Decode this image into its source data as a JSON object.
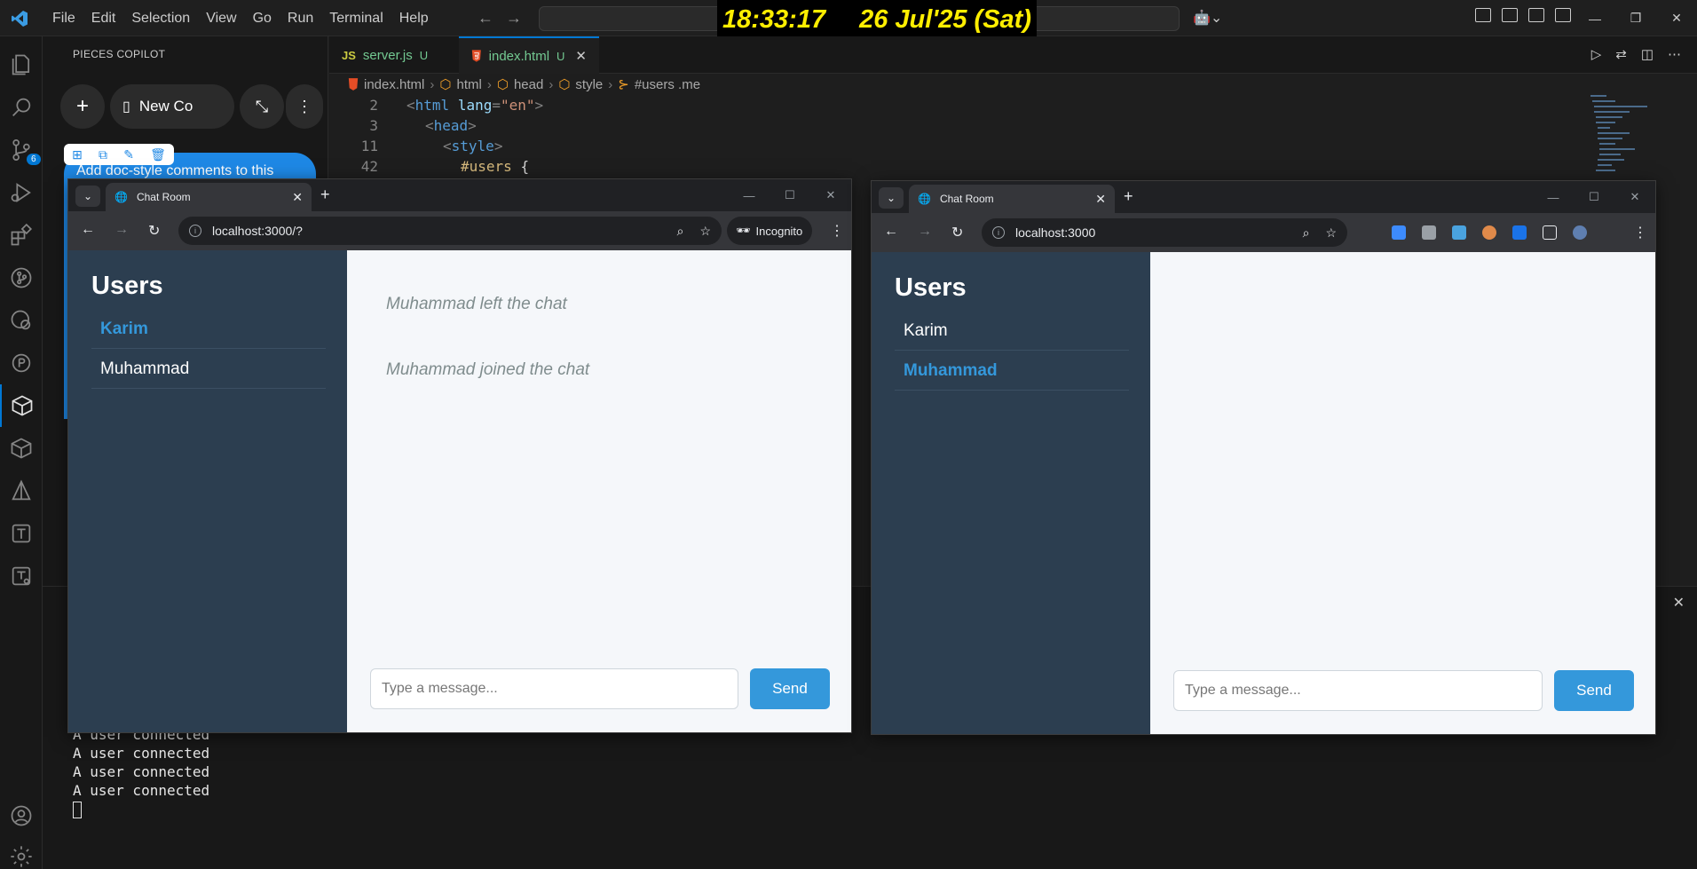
{
  "titlebar": {
    "menu": [
      "File",
      "Edit",
      "Selection",
      "View",
      "Go",
      "Run",
      "Terminal",
      "Help"
    ],
    "clock_time": "18:33:17",
    "clock_date": "26 Jul'25 (Sat)"
  },
  "activity": {
    "scm_badge": "6"
  },
  "pieces": {
    "title": "PIECES COPILOT",
    "new_conv_label": "New Co",
    "bubble_text": "Add doc-style comments to this"
  },
  "editor": {
    "tabs": [
      {
        "icon": "JS",
        "name": "server.js",
        "status": "U"
      },
      {
        "icon": "html5-icon",
        "name": "index.html",
        "status": "U"
      }
    ],
    "breadcrumb": [
      "index.html",
      "html",
      "head",
      "style",
      "#users .me"
    ],
    "lines": [
      {
        "n": "2",
        "text": "<html lang=\"en\">"
      },
      {
        "n": "3",
        "text": "<head>"
      },
      {
        "n": "11",
        "text": "<style>"
      },
      {
        "n": "42",
        "text": "#users {"
      }
    ]
  },
  "terminal": {
    "lines": [
      "A user connected",
      "A user connected",
      "A user connected",
      "A user connected"
    ]
  },
  "browser_left": {
    "tab_title": "Chat Room",
    "url": "localhost:3000/?",
    "incognito_label": "Incognito",
    "users_title": "Users",
    "users": [
      "Karim",
      "Muhammad"
    ],
    "me": "Karim",
    "messages": [
      "Muhammad left the chat",
      "Muhammad joined the chat"
    ],
    "input_placeholder": "Type a message...",
    "send_label": "Send"
  },
  "browser_right": {
    "tab_title": "Chat Room",
    "url": "localhost:3000",
    "users_title": "Users",
    "users": [
      "Karim",
      "Muhammad"
    ],
    "me": "Muhammad",
    "messages": [],
    "input_placeholder": "Type a message...",
    "send_label": "Send"
  },
  "colors": {
    "vscode_accent": "#0078d4",
    "chat_sidebar": "#2c3e50",
    "chat_accent": "#3498db",
    "clock_text": "#ffee00"
  }
}
